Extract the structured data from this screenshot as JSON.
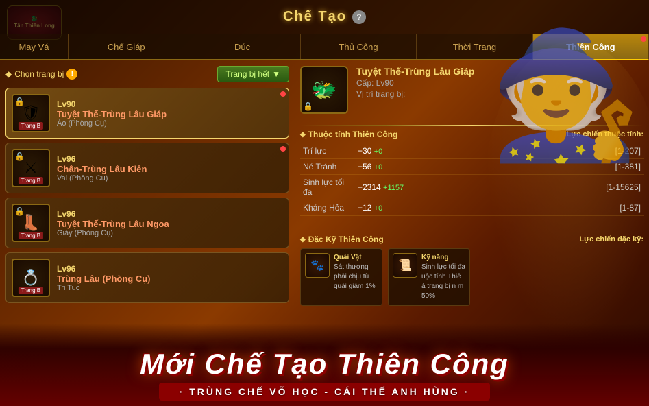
{
  "header": {
    "title": "Chế Tạo",
    "help_label": "?",
    "logo_text": "Tân Thiên Long"
  },
  "tabs": [
    {
      "id": "may-va",
      "label": "May Vá",
      "active": false,
      "dot": false
    },
    {
      "id": "che-giap",
      "label": "Chế Giáp",
      "active": false,
      "dot": false
    },
    {
      "id": "duc",
      "label": "Đúc",
      "active": false,
      "dot": false
    },
    {
      "id": "thu-cong",
      "label": "Thủ Công",
      "active": false,
      "dot": false
    },
    {
      "id": "thoi-trang",
      "label": "Thời Trang",
      "active": false,
      "dot": false
    },
    {
      "id": "thien-cong",
      "label": "Thiên Công",
      "active": true,
      "dot": true
    }
  ],
  "left": {
    "filter_label": "Chọn trang bị",
    "filter_warning": "!",
    "dropdown_label": "Trang bị hết",
    "dropdown_arrow": "▼",
    "items": [
      {
        "id": 1,
        "selected": true,
        "dot": true,
        "level": "Lv90",
        "name": "Tuyệt Thế-Trùng Lâu Giáp",
        "type": "Áo (Phòng Cụ)",
        "badge": "Trang B",
        "icon": "🛡",
        "locked": true
      },
      {
        "id": 2,
        "selected": false,
        "dot": true,
        "level": "Lv96",
        "name": "Chân-Trùng Lâu Kiên",
        "type": "Vai (Phòng Cụ)",
        "badge": "Trang B",
        "icon": "⚔",
        "locked": true
      },
      {
        "id": 3,
        "selected": false,
        "dot": false,
        "level": "Lv96",
        "name": "Tuyệt Thế-Trùng Lâu Ngoa",
        "type": "Giày (Phòng Cụ)",
        "badge": "Trang B",
        "icon": "👢",
        "locked": true
      },
      {
        "id": 4,
        "selected": false,
        "dot": false,
        "level": "Lv96",
        "name": "Trùng Lâu (Phòng Cụ)",
        "type": "Tri Tuc",
        "badge": "Trang B",
        "icon": "💍",
        "locked": false
      }
    ]
  },
  "right": {
    "item_name": "Tuyệt Thế-Trùng Lâu Giáp",
    "item_level": "Cấp: Lv90",
    "item_position": "Vị trí trang bị:",
    "attributes_title": "Thuộc tính Thiên Công",
    "attributes_right": "Lực chiến thuộc tính:",
    "attributes": [
      {
        "name": "Trí lực",
        "value": "+30",
        "bonus": "+0",
        "range": "[1-207]"
      },
      {
        "name": "Né Tránh",
        "value": "+56",
        "bonus": "+0",
        "range": "[1-381]"
      },
      {
        "name": "Sinh lực tối đa",
        "value": "+2314",
        "bonus": "+1157",
        "range": "[1-15625]"
      },
      {
        "name": "Kháng Hỏa",
        "value": "+12",
        "bonus": "+0",
        "range": "[1-87]"
      }
    ],
    "skills_title": "Đặc Kỹ Thiên Công",
    "skills_right": "Lực chiến đặc kỹ:",
    "skills": [
      {
        "icon": "🐾",
        "label": "Quái Vật",
        "text": "Sát thương phải chịu từ quái giảm 1%"
      },
      {
        "icon": "📜",
        "label": "Kỹ năng",
        "text": "Sinh lực tối đa uộc tính Thiê à trang bị n m 50%"
      }
    ]
  },
  "banner": {
    "main_text": "Mới Chế Tạo Thiên Công",
    "sub_text": "· TRÙNG CHẾ VÕ HỌC - CÁI THẾ ANH HÙNG ·"
  }
}
